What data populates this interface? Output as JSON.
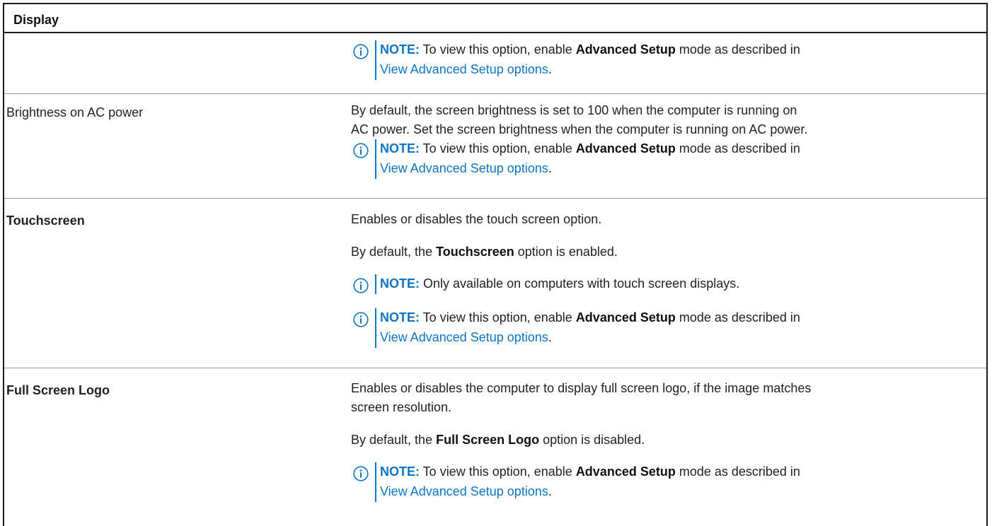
{
  "header": {
    "title": "Display"
  },
  "note_common": {
    "label": "NOTE:",
    "text_before": " To view this option, enable ",
    "bold": "Advanced Setup",
    "text_after": " mode as described in",
    "link": "View Advanced Setup options",
    "period": "."
  },
  "rows": [
    {
      "label": "",
      "notes": [
        "advanced"
      ]
    },
    {
      "label": "Brightness on AC power",
      "desc": [
        "By default, the screen brightness is set to 100 when the computer is running on",
        "AC power. Set the screen brightness when the computer is running on AC power."
      ]
    },
    {
      "label": "Touchscreen",
      "desc1": "Enables or disables the touch screen option.",
      "desc2_before": "By default, the ",
      "desc2_bold": "Touchscreen",
      "desc2_after": " option is enabled.",
      "note_only": "Only available on computers with touch screen displays."
    },
    {
      "label": "Full Screen Logo",
      "desc": [
        "Enables or disables the computer to display full screen logo, if the image matches",
        "screen resolution."
      ],
      "desc2_before": "By default, the ",
      "desc2_bold": "Full Screen Logo",
      "desc2_after": " option is disabled."
    }
  ],
  "colors": {
    "accent": "#0e75c4",
    "text": "#222222",
    "border": "#1a1a1a"
  },
  "icon_names": [
    "info-icon"
  ]
}
